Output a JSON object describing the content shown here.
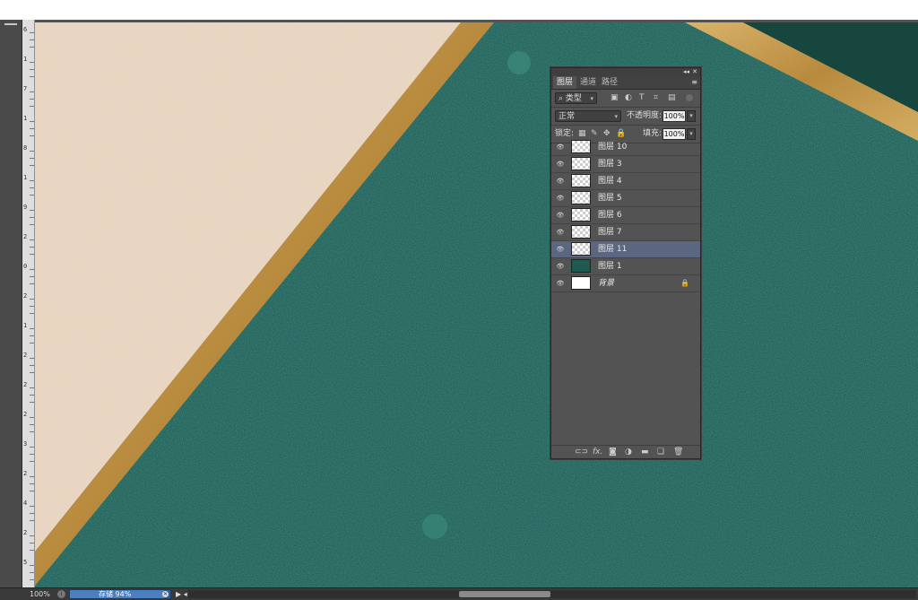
{
  "ruler": {
    "ticks": [
      "6",
      "1",
      "7",
      "1",
      "8",
      "1",
      "9",
      "2",
      "0",
      "2",
      "1",
      "2",
      "2",
      "2",
      "3",
      "2",
      "4",
      "2",
      "5"
    ]
  },
  "layers_panel": {
    "collapse_label": "◂◂",
    "close_label": "✕",
    "tabs": [
      "图层",
      "通道",
      "路径"
    ],
    "menu_icon": "≡",
    "filter": {
      "label": "类型",
      "icons": [
        "image-filter-icon",
        "adjust-filter-icon",
        "text-filter-icon",
        "shape-filter-icon",
        "smart-filter-icon"
      ]
    },
    "blend_mode": "正常",
    "opacity_label": "不透明度:",
    "opacity_value": "100%",
    "lock_label": "锁定:",
    "fill_label": "填充:",
    "fill_value": "100%",
    "layers": [
      {
        "name": "图层 10",
        "thumb": "trans",
        "selected": false
      },
      {
        "name": "图层 3",
        "thumb": "trans",
        "selected": false
      },
      {
        "name": "图层 4",
        "thumb": "trans",
        "selected": false
      },
      {
        "name": "图层 5",
        "thumb": "trans",
        "selected": false
      },
      {
        "name": "图层 6",
        "thumb": "trans",
        "selected": false
      },
      {
        "name": "图层 7",
        "thumb": "trans",
        "selected": false
      },
      {
        "name": "图层 11",
        "thumb": "trans",
        "selected": true
      },
      {
        "name": "图层 1",
        "thumb": "green",
        "selected": false
      },
      {
        "name": "背景",
        "thumb": "white",
        "selected": false,
        "locked": true
      }
    ],
    "footer_icons": [
      "link-icon",
      "fx-icon",
      "mask-icon",
      "adjustment-icon",
      "folder-icon",
      "new-layer-icon",
      "trash-icon"
    ],
    "footer_fx": "fx."
  },
  "status": {
    "zoom": "100%",
    "progress_label": "存储 94%",
    "progress": 0.94
  },
  "colors": {
    "beige": "#eeddca",
    "gold": "#c79a4d",
    "teal": "#1c5a52",
    "selected_layer": "#5b6680"
  }
}
